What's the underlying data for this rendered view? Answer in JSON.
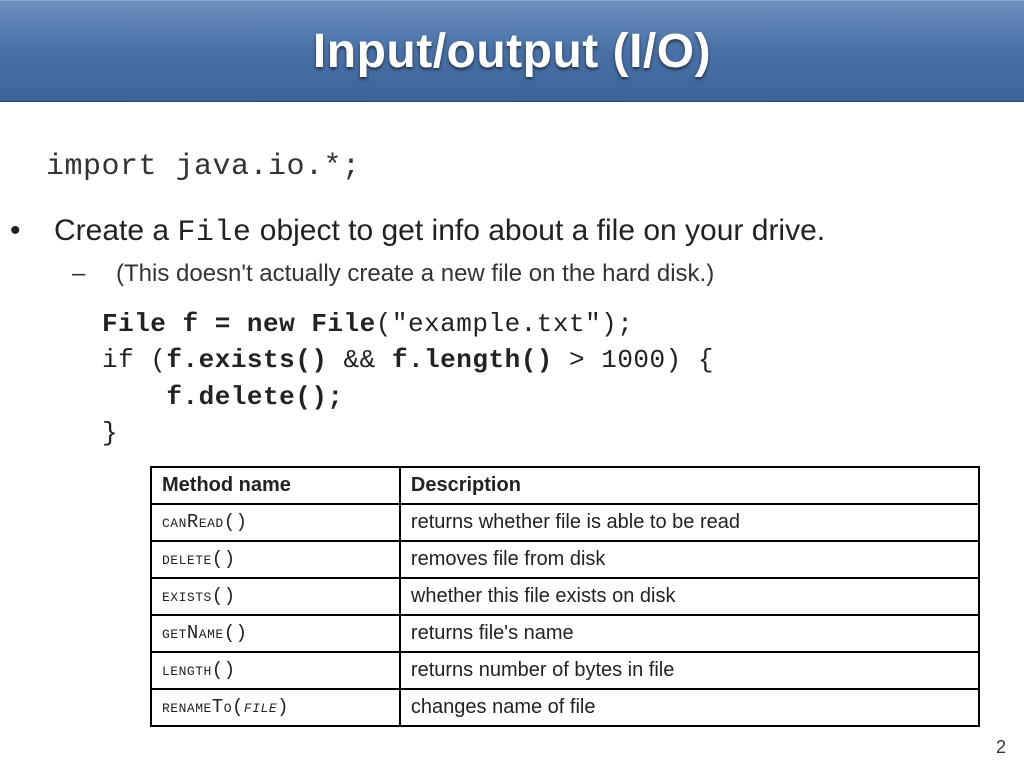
{
  "title": "Input/output (I/O)",
  "import_line": "import java.io.*;",
  "bullet1_pre": "Create a ",
  "bullet1_code": "File",
  "bullet1_post": " object to get info about a file on your drive.",
  "bullet2": "(This doesn't actually create a new file on the hard disk.)",
  "code": {
    "l1a": "File f = new File",
    "l1b": "(\"example.txt\");",
    "l2a": "if (",
    "l2b": "f.exists()",
    "l2c": " && ",
    "l2d": "f.length()",
    "l2e": " > 1000) {",
    "l3": "    f.delete();",
    "l4": "}"
  },
  "table": {
    "h1": "Method name",
    "h2": "Description",
    "rows": [
      {
        "m": "canRead()",
        "d": "returns whether file is able to be read"
      },
      {
        "m": "delete()",
        "d": "removes file from disk"
      },
      {
        "m": "exists()",
        "d": "whether this file exists on disk"
      },
      {
        "m": "getName()",
        "d": "returns file's name"
      },
      {
        "m": "length()",
        "d": "returns number of bytes in file"
      },
      {
        "m": "renameTo(",
        "param": "file",
        "m2": ")",
        "d": "changes name of file"
      }
    ]
  },
  "page_number": "2"
}
